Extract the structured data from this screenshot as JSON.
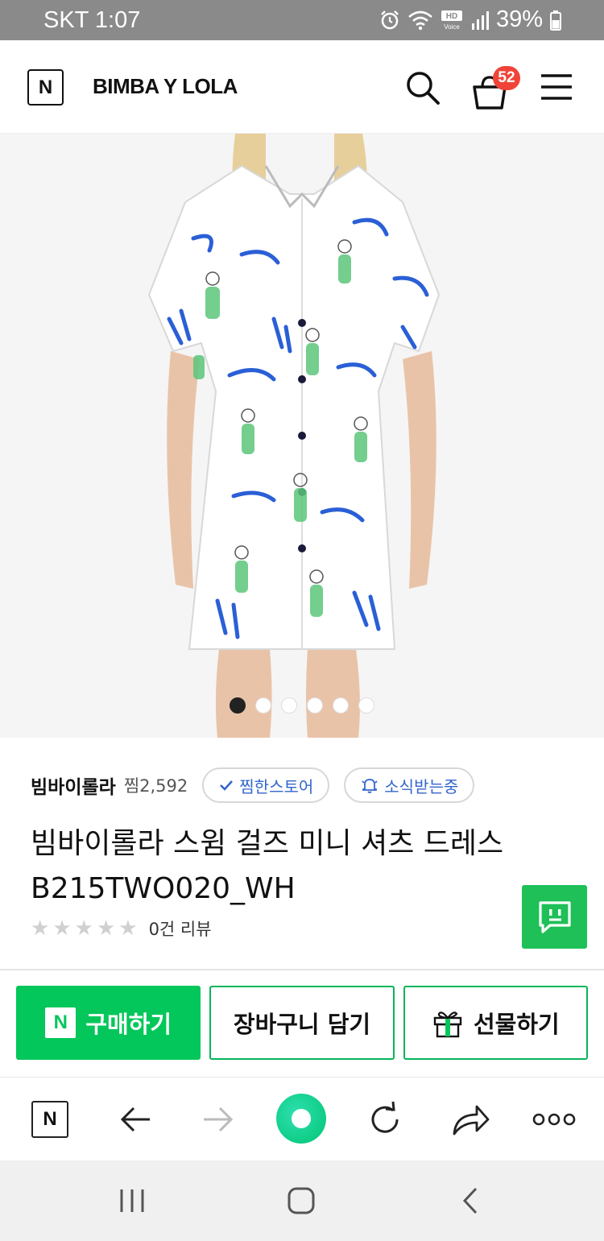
{
  "status_bar": {
    "carrier_time": "SKT 1:07",
    "battery": "39%",
    "icons": [
      "alarm-icon",
      "wifi-icon",
      "hd-voice-icon",
      "signal-icon",
      "battery-icon"
    ]
  },
  "header": {
    "logo": "N",
    "brand": "BIMBA Y LOLA",
    "cart_count": "52"
  },
  "product": {
    "image_alt": "빔바이롤라 스윔 걸즈 미니 셔츠 드레스",
    "carousel": {
      "total": 6,
      "active_index": 0
    },
    "store_name": "빔바이롤라",
    "store_likes": "찜2,592",
    "liked_store_label": "찜한스토어",
    "subscribed_label": "소식받는중",
    "title_line1": "빔바이롤라 스윔 걸즈 미니 셔츠 드레스",
    "title_line2": "B215TWO020_WH",
    "rating": 0,
    "review_text": "0건 리뷰"
  },
  "actions": {
    "buy_logo": "N",
    "buy_label": "구매하기",
    "cart_label": "장바구니 담기",
    "gift_label": "선물하기"
  },
  "browser_bar": {
    "home_logo": "N"
  },
  "colors": {
    "naver_green": "#03c75a",
    "badge_red": "#f04438",
    "pill_blue": "#3366cc",
    "status_gray": "#8a8a8a"
  }
}
